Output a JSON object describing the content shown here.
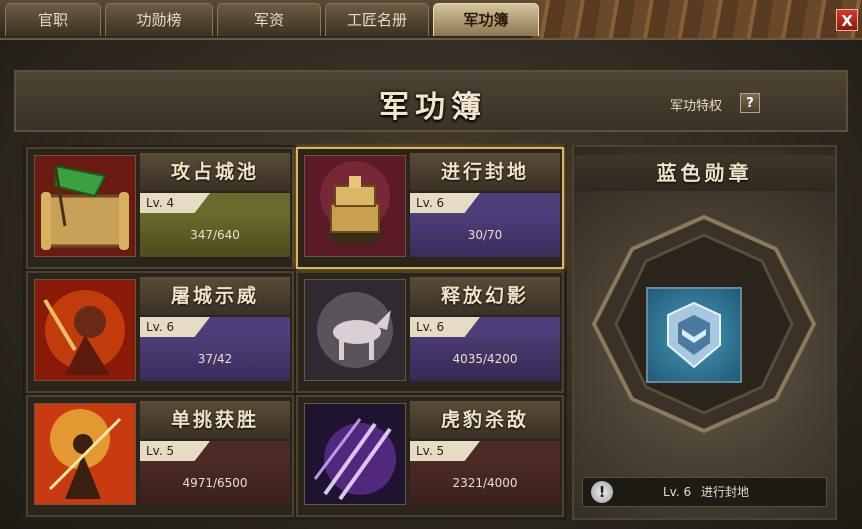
{
  "tabs": [
    {
      "label": "官职",
      "active": false
    },
    {
      "label": "功勋榜",
      "active": false
    },
    {
      "label": "军资",
      "active": false
    },
    {
      "label": "工匠名册",
      "active": false
    },
    {
      "label": "军功簿",
      "active": true
    }
  ],
  "close_label": "X",
  "header": {
    "title": "军功簿",
    "privilege_label": "军功特权",
    "help_label": "?"
  },
  "cards": [
    {
      "name": "攻占城池",
      "level": "Lv. 4",
      "progress": "347/640",
      "icon": "scroll-flag-icon",
      "selected": false
    },
    {
      "name": "进行封地",
      "level": "Lv. 6",
      "progress": "30/70",
      "icon": "treasure-box-icon",
      "selected": true
    },
    {
      "name": "屠城示威",
      "level": "Lv. 6",
      "progress": "37/42",
      "icon": "warrior-fire-icon",
      "selected": false
    },
    {
      "name": "释放幻影",
      "level": "Lv. 6",
      "progress": "4035/4200",
      "icon": "phantom-horse-icon",
      "selected": false
    },
    {
      "name": "单挑获胜",
      "level": "Lv. 5",
      "progress": "4971/6500",
      "icon": "spear-warrior-icon",
      "selected": false
    },
    {
      "name": "虎豹杀敌",
      "level": "Lv. 5",
      "progress": "2321/4000",
      "icon": "purple-spears-icon",
      "selected": false
    }
  ],
  "medal": {
    "title": "蓝色勋章",
    "icon": "blue-medal-icon",
    "footer_level": "Lv. 6",
    "footer_text": "进行封地",
    "warn_label": "!"
  }
}
